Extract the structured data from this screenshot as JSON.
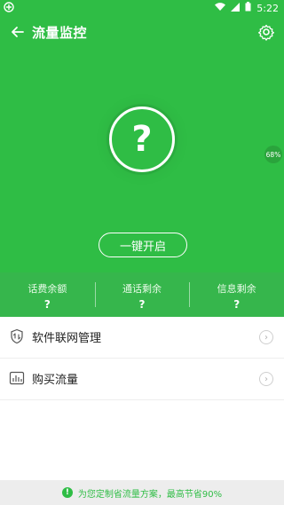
{
  "status_bar": {
    "time": "5:22",
    "battery_icon": "battery-icon",
    "wifi_icon": "wifi-icon",
    "signal_icon": "signal-icon"
  },
  "header": {
    "title": "流量监控",
    "back_icon": "back-arrow-icon",
    "settings_icon": "gear-icon"
  },
  "center": {
    "symbol": "?",
    "badge": "68%",
    "button_label": "一键开启"
  },
  "stats": [
    {
      "label": "话费余额",
      "value": "?"
    },
    {
      "label": "通话剩余",
      "value": "?"
    },
    {
      "label": "信息剩余",
      "value": "?"
    }
  ],
  "menu": [
    {
      "label": "软件联网管理",
      "icon": "network-shield-icon"
    },
    {
      "label": "购买流量",
      "icon": "chart-icon"
    }
  ],
  "footer": {
    "text": "为您定制省流量方案，最高节省90%"
  },
  "colors": {
    "primary": "#2fbd45",
    "stats_bg": "#36b64c",
    "white": "#ffffff"
  }
}
